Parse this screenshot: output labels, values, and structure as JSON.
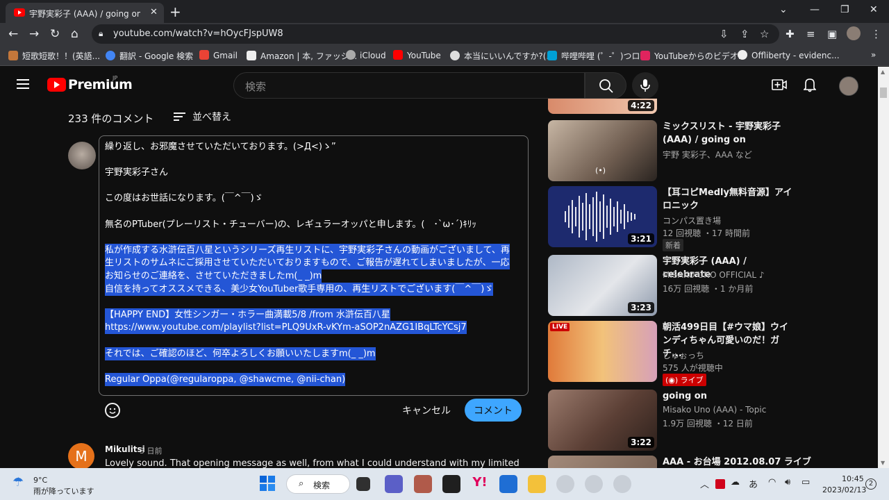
{
  "browser": {
    "tab_title": "宇野実彩子 (AAA) / going on - Yo",
    "url": "youtube.com/watch?v=hOycFJspUW8",
    "bookmarks": [
      {
        "label": "短歌短歌！！(英語...",
        "color": "#c4773b"
      },
      {
        "label": "翻訳 - Google 検索",
        "color": "#4285f4"
      },
      {
        "label": "Gmail",
        "color": "#ea4335"
      },
      {
        "label": "Amazon | 本, ファッシ...",
        "color": "#222222"
      },
      {
        "label": "iCloud",
        "color": "#aaaaaa"
      },
      {
        "label": "YouTube",
        "color": "#ff0000"
      },
      {
        "label": "本当にいいんですか?(...",
        "color": "#dddddd"
      },
      {
        "label": "哔哩哔哩 (゜-゜)つロ...",
        "color": "#00a1d6"
      },
      {
        "label": "YouTubeからのビデオ...",
        "color": "#e0245e"
      },
      {
        "label": "Offliberty - evidenc...",
        "color": "#eeeeee"
      }
    ]
  },
  "header": {
    "logo_text": "Premium",
    "region": "JP",
    "search_placeholder": "検索"
  },
  "comments": {
    "count_label": "233 件のコメント",
    "sort_label": "並べ替え",
    "draft_lines": [
      {
        "text": "繰り返し、お邪魔させていただいております。(>Д<)ゝ”",
        "selected": false
      },
      {
        "text": "",
        "selected": false
      },
      {
        "text": "宇野実彩子さん",
        "selected": false
      },
      {
        "text": "",
        "selected": false
      },
      {
        "text": "この度はお世話になります。(￣^￣)ゞ",
        "selected": false
      },
      {
        "text": "",
        "selected": false
      },
      {
        "text": "無名のPTuber(プレーリスト・チューバー)の、レギュラーオッパと申します。(　･`ω･´)ｷﾘｯ",
        "selected": false
      },
      {
        "text": "",
        "selected": false
      },
      {
        "text": "私が作成する水滸伝百八星というシリーズ再生リストに、宇野実彩子さんの動画がございまして、再",
        "selected": true
      },
      {
        "text": "生リストのサムネにご採用させていただいておりますもので、ご報告が遅れてしまいましたが、一応",
        "selected": true
      },
      {
        "text": "お知らせのご連絡を、させていただきましたm(_ _)m",
        "selected": true
      },
      {
        "text": "自信を持ってオススメできる、美少女YouTuber歌手専用の、再生リストでございます(￣^￣)ゞ",
        "selected": true
      },
      {
        "text": " ",
        "selected": true
      },
      {
        "text": "【HAPPY END】女性シンガー・ホラー曲満載5/8 /from 水滸伝百八星",
        "selected": true
      },
      {
        "text": "https://www.youtube.com/playlist?list=PLQ9UxR-vKYm-aSOP2nAZG1IBqLTcYCsj7",
        "selected": true
      },
      {
        "text": " ",
        "selected": true
      },
      {
        "text": "それでは、ご確認のほど、何卒よろしくお願いいたしますm(_ _)m",
        "selected": true
      },
      {
        "text": " ",
        "selected": true
      },
      {
        "text": "Regular Oppa(@regularoppa, @shawcme, @nii-chan)",
        "selected": true
      }
    ],
    "cancel_label": "キャンセル",
    "submit_label": "コメント",
    "next": {
      "avatar_letter": "M",
      "author": "Mikulitsi",
      "time": "3 日前",
      "text": "Lovely sound. That opening message as well, from what I could understand with my limited"
    }
  },
  "sidebar": {
    "top_duration": "4:22",
    "videos": [
      {
        "title": "ミックスリスト - 宇野実彩子 (AAA) / going on",
        "channel": "宇野 実彩子、AAA など",
        "meta": "",
        "duration": "",
        "badge": "",
        "thumb_color": "#9c8d80"
      },
      {
        "title": "【耳コピMedly無料音源】アイロニック",
        "channel": "コンパス置き場",
        "meta": "12 回視聴 ・17 時間前",
        "duration": "3:21",
        "badge": "新着",
        "thumb_color": "#1d2a6e"
      },
      {
        "title": "宇野実彩子 (AAA) / celebrate",
        "channel": "MISAKO UNO OFFICIAL ♪",
        "meta": "16万 回視聴 ・1 か月前",
        "duration": "3:23",
        "badge": "",
        "thumb_color": "#c9cfd9"
      },
      {
        "title": "朝活499日目【#ウマ娘】ウインディちゃん可愛いのだ！ガチ...",
        "channel": "しゅぉっち",
        "meta": "575 人が視聴中",
        "duration": "",
        "badge": "(◉) ライブ",
        "thumb_color": "#e07a3a"
      },
      {
        "title": "going on",
        "channel": "Misako Uno (AAA) - Topic",
        "meta": "1.9万 回視聴 ・12 日前",
        "duration": "3:22",
        "badge": "",
        "thumb_color": "#6b4b40"
      },
      {
        "title": "AAA - お台場 2012.08.07 ライブ",
        "channel": "",
        "meta": "",
        "duration": "",
        "badge": "",
        "thumb_color": "#8a7060"
      }
    ]
  },
  "taskbar": {
    "temp": "9°C",
    "weather": "雨が降っています",
    "search_label": "検索",
    "ime": "あ",
    "time": "10:45",
    "date": "2023/02/13",
    "notifications": "2"
  }
}
